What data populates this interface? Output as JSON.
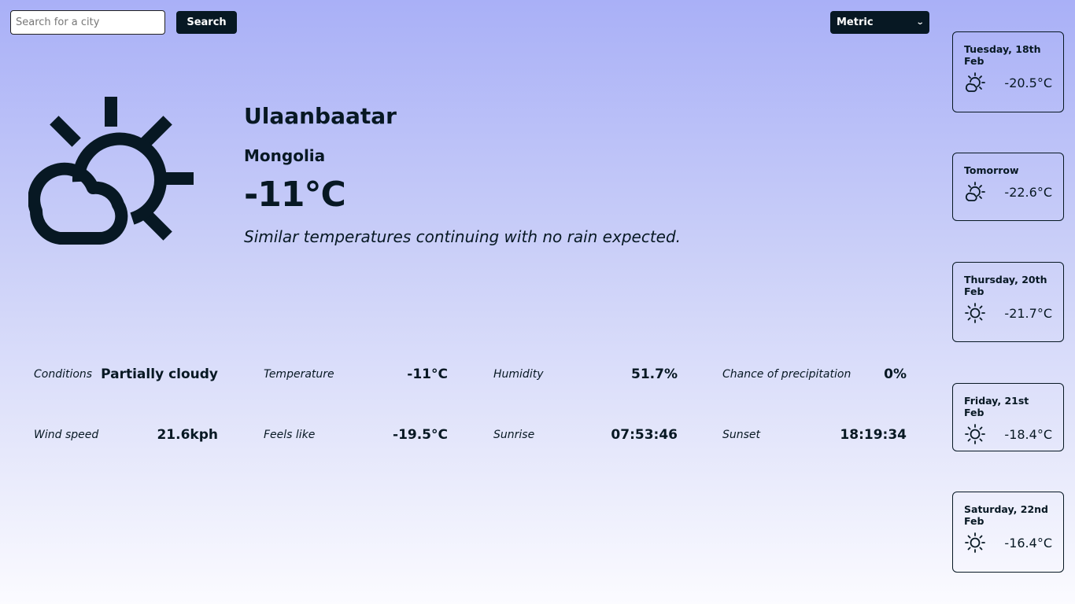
{
  "search": {
    "placeholder": "Search for a city",
    "value": "",
    "button_label": "Search"
  },
  "units": {
    "selected": "Metric"
  },
  "current": {
    "city": "Ulaanbaatar",
    "country": "Mongolia",
    "temperature": "-11°C",
    "description": "Similar temperatures continuing with no rain expected.",
    "icon": "partly-cloudy-day-icon"
  },
  "stats": [
    {
      "label": "Conditions",
      "value": "Partially cloudy"
    },
    {
      "label": "Temperature",
      "value": "-11°C"
    },
    {
      "label": "Humidity",
      "value": "51.7%"
    },
    {
      "label": "Chance of precipitation",
      "value": "0%"
    },
    {
      "label": "Wind speed",
      "value": "21.6kph"
    },
    {
      "label": "Feels like",
      "value": "-19.5°C"
    },
    {
      "label": "Sunrise",
      "value": "07:53:46"
    },
    {
      "label": "Sunset",
      "value": "18:19:34"
    }
  ],
  "forecast": [
    {
      "day": "Tuesday, 18th Feb",
      "temp": "-20.5°C",
      "icon": "partly-cloudy-day-icon"
    },
    {
      "day": "Tomorrow",
      "temp": "-22.6°C",
      "icon": "partly-cloudy-day-icon"
    },
    {
      "day": "Thursday, 20th Feb",
      "temp": "-21.7°C",
      "icon": "sun-icon"
    },
    {
      "day": "Friday, 21st Feb",
      "temp": "-18.4°C",
      "icon": "sun-icon"
    },
    {
      "day": "Saturday, 22nd Feb",
      "temp": "-16.4°C",
      "icon": "sun-icon"
    }
  ],
  "colors": {
    "ink": "#071823",
    "gradient_top": "#a9b0f7",
    "gradient_bottom": "#fbfbff"
  }
}
